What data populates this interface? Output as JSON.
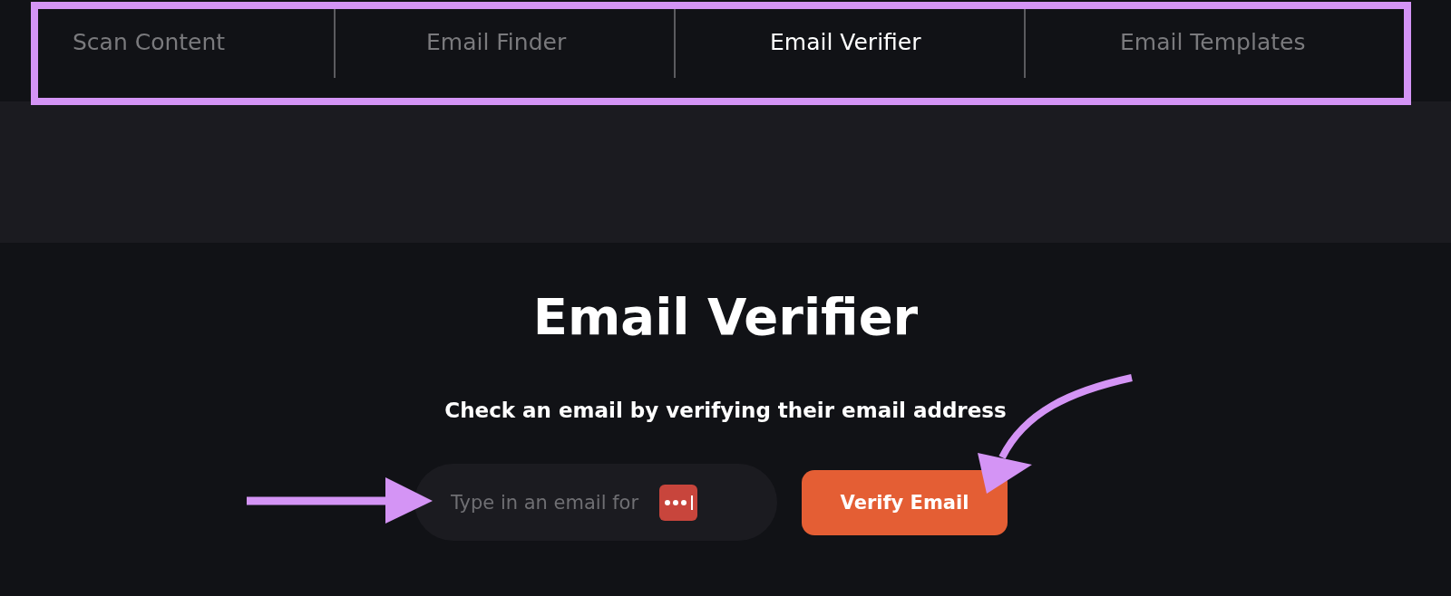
{
  "tabs": [
    {
      "label": "Scan Content",
      "selected": false
    },
    {
      "label": "Email Finder",
      "selected": false
    },
    {
      "label": "Email Verifier",
      "selected": true
    },
    {
      "label": "Email Templates",
      "selected": false
    }
  ],
  "heading": "Email Verifier",
  "subtitle": "Check an email by verifying their email address",
  "email_field": {
    "placeholder": "Type in an email for"
  },
  "button": "Verify Email"
}
